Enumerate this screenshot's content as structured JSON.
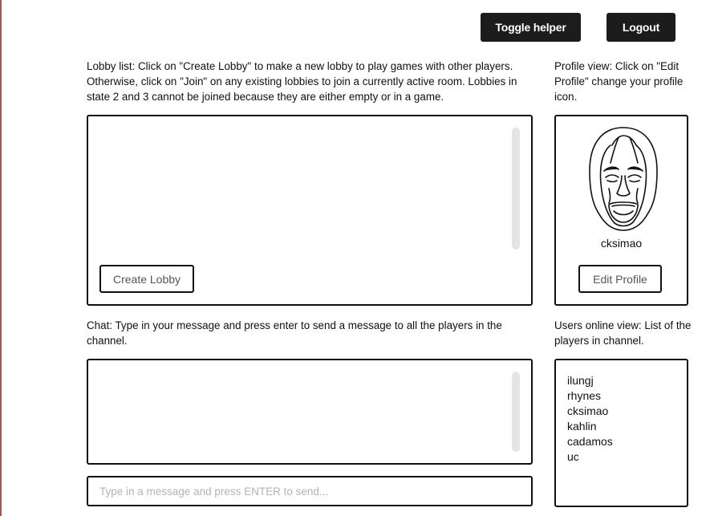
{
  "header": {
    "toggle_helper_label": "Toggle helper",
    "logout_label": "Logout"
  },
  "lobby": {
    "helper_text": "Lobby list: Click on \"Create Lobby\" to make a new lobby to play games with other players. Otherwise, click on \"Join\" on any existing lobbies to join a currently active room. Lobbies in state 2 and 3 cannot be joined because they are either empty or in a game.",
    "create_label": "Create Lobby",
    "items": []
  },
  "profile": {
    "helper_text": "Profile view: Click on \"Edit Profile\" change your profile icon.",
    "username": "cksimao",
    "edit_label": "Edit Profile",
    "avatar_icon": "screaming-face-icon"
  },
  "chat": {
    "helper_text": "Chat: Type in your message and press enter to send a message to all the players in the channel.",
    "messages": [],
    "input_placeholder": "Type in a message and press ENTER to send...",
    "input_value": ""
  },
  "users_online": {
    "helper_text": "Users online view: List of the players in channel.",
    "users": [
      "ilungj",
      "rhynes",
      "cksimao",
      "kahlin",
      "cadamos",
      "uc"
    ]
  },
  "colors": {
    "button_dark": "#1c1c1c",
    "border": "#111111",
    "scrollbar": "#e4e4e4",
    "placeholder": "#b3b3b3",
    "left_edge": "#9a5a52"
  }
}
